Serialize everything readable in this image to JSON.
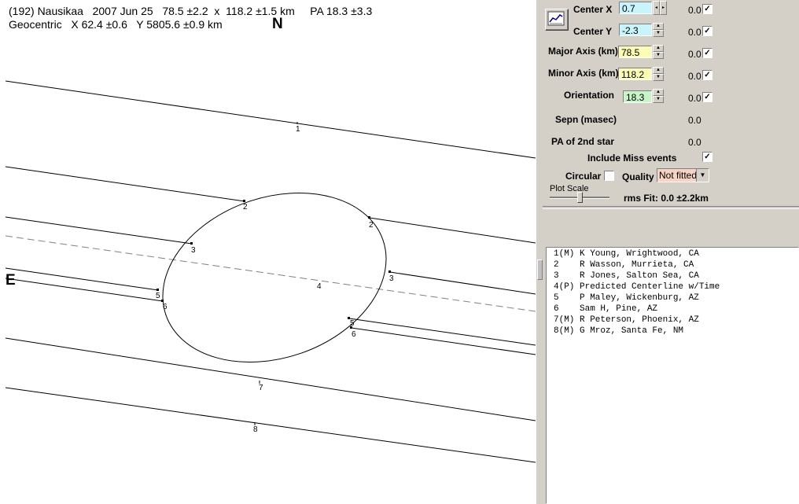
{
  "plot": {
    "header_line_1": "(192) Nausikaa   2007 Jun 25   78.5 ±2.2  x  118.2 ±1.5 km     PA 18.3 ±3.3",
    "header_line_2": "Geocentric   X 62.4 ±0.6   Y 5805.6 ±0.9 km",
    "north_label": "N",
    "east_label": "E",
    "chord_labels": [
      "1",
      "2",
      "2",
      "3",
      "3",
      "4",
      "5",
      "6",
      "5",
      "6",
      "7",
      "8"
    ]
  },
  "controls": {
    "center_x": {
      "label": "Center X",
      "value": "0.7",
      "uncert": "0.0",
      "checked": true,
      "bg": "#c8f4fc"
    },
    "center_y": {
      "label": "Center Y",
      "value": "-2.3",
      "uncert": "0.0",
      "checked": true,
      "bg": "#c8f4fc"
    },
    "major_axis": {
      "label": "Major Axis (km)",
      "value": "78.5",
      "uncert": "0.0",
      "checked": true,
      "bg": "#fcfcb8"
    },
    "minor_axis": {
      "label": "Minor Axis (km)",
      "value": "118.2",
      "uncert": "0.0",
      "checked": true,
      "bg": "#fcfcb8"
    },
    "orientation": {
      "label": "Orientation",
      "value": "18.3",
      "uncert": "0.0",
      "checked": true,
      "bg": "#c8f4c8"
    },
    "sepn": {
      "label": "Sepn (masec)",
      "value": "0.0"
    },
    "pa_2nd_star": {
      "label": "PA of 2nd star",
      "value": "0.0"
    },
    "include_miss": {
      "label": "Include Miss events",
      "checked": true
    },
    "circular": {
      "label": "Circular",
      "checked": false
    },
    "quality": {
      "label": "Quality",
      "value": "Not fitted"
    },
    "plot_scale": {
      "label": "Plot Scale"
    },
    "rms_fit": "rms Fit: 0.0 ±2.2km",
    "check_mark": "✓"
  },
  "observers": [
    "1(M) K Young, Wrightwood, CA",
    "2    R Wasson, Murrieta, CA",
    "3    R Jones, Salton Sea, CA",
    "4(P) Predicted Centerline w/Time",
    "5    P Maley, Wickenburg, AZ",
    "6    Sam H, Pine, AZ",
    "7(M) R Peterson, Phoenix, AZ",
    "8(M) G Mroz, Santa Fe, NM"
  ],
  "icons": {
    "chart_button": "line-chart-icon"
  }
}
